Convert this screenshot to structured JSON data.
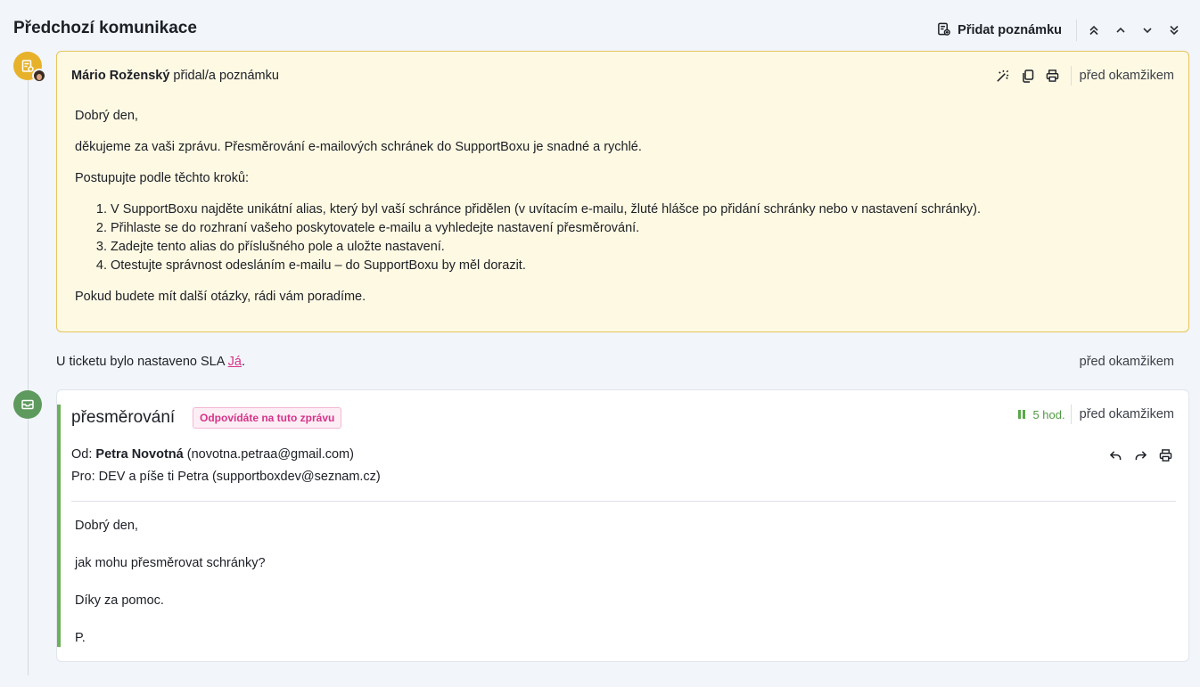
{
  "header": {
    "title": "Předchozí komunikace",
    "add_note_label": "Přidat poznámku"
  },
  "note": {
    "author": "Mário Roženský",
    "action": " přidal/a poznámku",
    "time": "před okamžikem",
    "body": {
      "greeting": "Dobrý den,",
      "intro": "děkujeme za vaši zprávu. Přesměrování e-mailových schránek do SupportBoxu je snadné a rychlé.",
      "steps_intro": "Postupujte podle těchto kroků:",
      "steps": [
        "V SupportBoxu najděte unikátní alias, který byl vaší schránce přidělen (v uvítacím e-mailu, žluté hlášce po přidání schránky nebo v nastavení schránky).",
        "Přihlaste se do rozhraní vašeho poskytovatele e-mailu a vyhledejte nastavení přesměrování.",
        "Zadejte tento alias do příslušného pole a uložte nastavení.",
        "Otestujte správnost odesláním e-mailu – do SupportBoxu by měl dorazit."
      ],
      "closing": "Pokud budete mít další otázky, rádi vám poradíme."
    }
  },
  "sla_event": {
    "text_before": "U ticketu bylo nastaveno SLA ",
    "link": "Já",
    "text_after": ".",
    "time": "před okamžikem"
  },
  "mail": {
    "subject": "přesměrování",
    "badge": "Odpovídáte na tuto zprávu",
    "sla_remaining": "5 hod.",
    "time": "před okamžikem",
    "from_label": "Od: ",
    "from_name": "Petra Novotná",
    "from_email": " (novotna.petraa@gmail.com)",
    "to": "Pro: DEV a píše ti Petra (supportboxdev@seznam.cz)",
    "body": [
      "Dobrý den,",
      "jak mohu přesměrovat schránky?",
      "Díky za pomoc.",
      "P."
    ]
  },
  "colors": {
    "note_bg": "#fef9e3",
    "note_border": "#e6c55c",
    "note_avatar": "#e7b22a",
    "mail_avatar": "#5e9a5e",
    "mail_accent": "#6bb05a",
    "badge_pink": "#d6338a"
  },
  "icons": {
    "add_note": "note-plus-icon",
    "nav": [
      "chevrons-up-icon",
      "chevron-up-icon",
      "chevron-down-icon",
      "chevrons-down-icon"
    ],
    "note_actions": [
      "magic-wand-icon",
      "copy-icon",
      "print-icon"
    ],
    "mail_actions": [
      "reply-icon",
      "forward-icon",
      "print-icon"
    ]
  }
}
